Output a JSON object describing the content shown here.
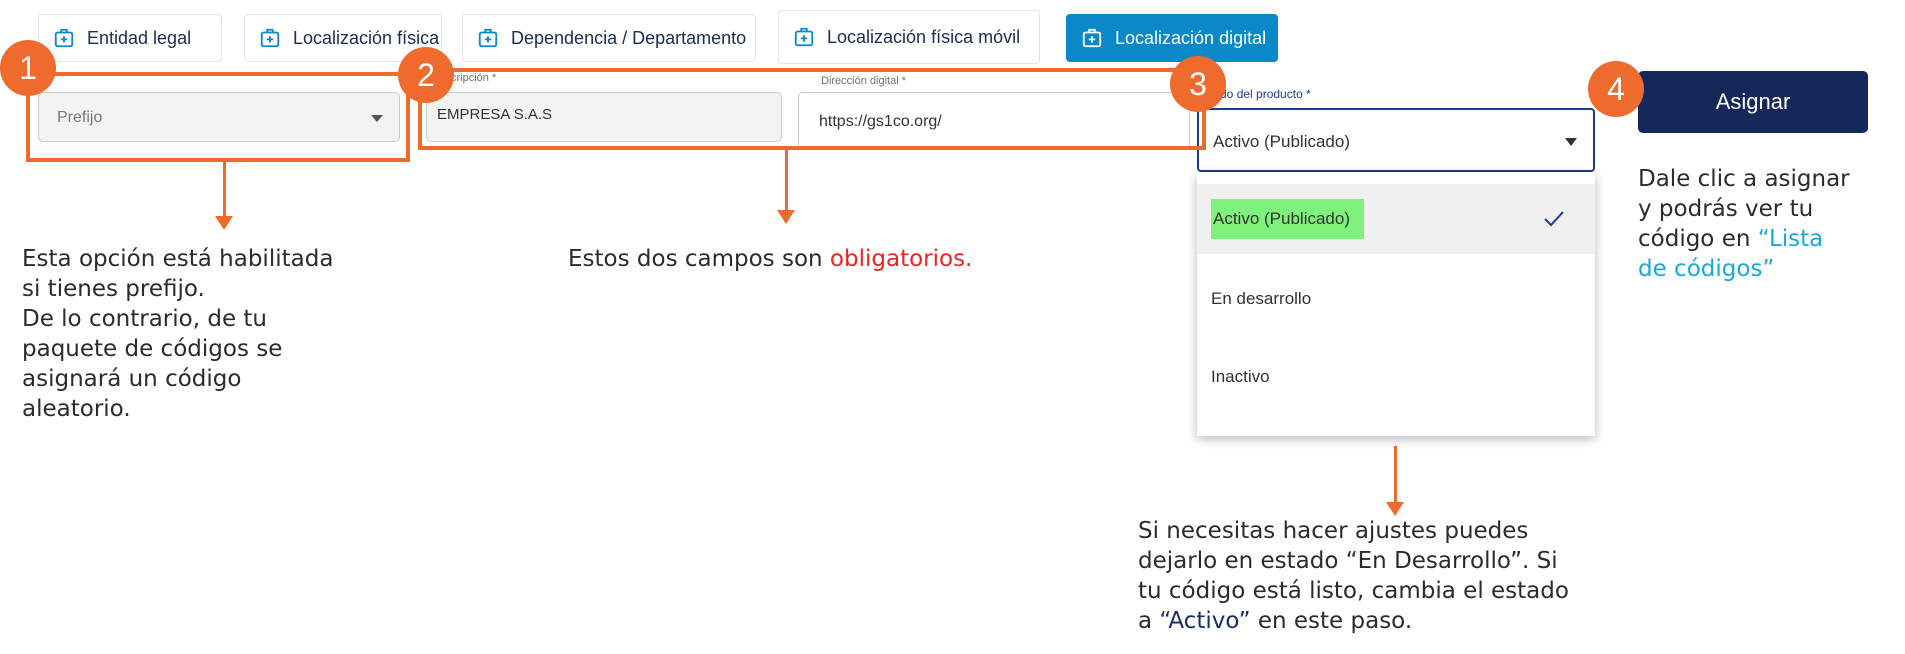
{
  "tabs": [
    {
      "label": "Entidad legal"
    },
    {
      "label": "Localización física"
    },
    {
      "label": "Dependencia / Departamento"
    },
    {
      "label": "Localización física móvil"
    },
    {
      "label": "Localización digital"
    }
  ],
  "fields": {
    "prefix": {
      "placeholder": "Prefijo"
    },
    "description": {
      "label": "cripción *",
      "value": "EMPRESA S.A.S"
    },
    "digital_address": {
      "label": "Dirección digital *",
      "value": "https://gs1co.org/"
    },
    "product_state": {
      "label": "tado del producto *",
      "value": "Activo (Publicado)"
    }
  },
  "dropdown": {
    "options": [
      "Activo (Publicado)",
      "En desarrollo",
      "Inactivo"
    ],
    "selected_index": 0
  },
  "assign_button": {
    "label": "Asignar"
  },
  "badges": [
    "1",
    "2",
    "3",
    "4"
  ],
  "notes": {
    "prefix": [
      "Esta opción está habilitada",
      "si tienes prefijo.",
      "De lo contrario, de tu",
      "paquete de códigos se",
      "asignará un código",
      "aleatorio."
    ],
    "required_start": "Estos dos campos son ",
    "required_highlight": "obligatorios.",
    "state": [
      "Si necesitas hacer ajustes puedes",
      "dejarlo en estado “En Desarrollo”. Si",
      "tu código está listo, cambia el estado"
    ],
    "state_last_prefix": "a ",
    "state_last_highlight": "“Activo”",
    "state_last_suffix": " en este paso.",
    "assign_line1": "Dale clic a asignar",
    "assign_line2": "y podrás ver tu",
    "assign_line3_prefix": "código en ",
    "assign_line3_highlight": "“Lista",
    "assign_line4": "de códigos”"
  },
  "colors": {
    "accent": "#ee6a2d",
    "tab_active": "#0a88c8",
    "button": "#14295a",
    "highlight_green": "#7ef27a",
    "required_red": "#ee2222",
    "link_cyan": "#17a9d8",
    "navy_text": "#1a2d6b"
  }
}
